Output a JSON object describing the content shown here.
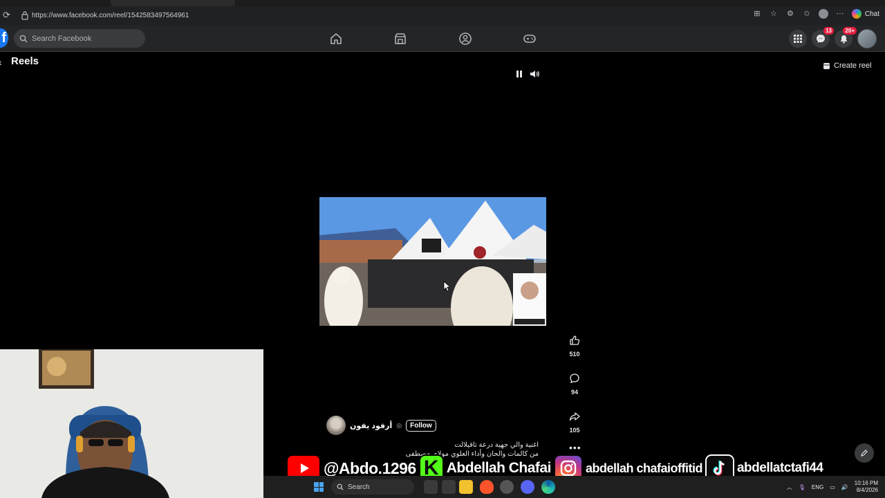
{
  "browser": {
    "url": "https://www.facebook.com/reel/1542583497564961",
    "chat_label": "Chat"
  },
  "facebook": {
    "search_placeholder": "Search Facebook",
    "messenger_badge": "13",
    "notifications_badge": "20+"
  },
  "reels": {
    "title": "Reels",
    "create_reel_label": "Create reel"
  },
  "actions": {
    "likes": "510",
    "comments": "94",
    "shares": "105"
  },
  "author": {
    "name": "أرفود يفون",
    "follow_label": "Follow"
  },
  "caption": {
    "line1": "اغنية والي جهية درعة تافيلالت",
    "line2": "من كالمات والحان وأداء العلوي مولاي مصطفى"
  },
  "social_overlay": {
    "youtube": "@Abdo.1296",
    "kick": "Abdellah Chafai",
    "instagram": "abdellah chafaioffitid",
    "tiktok": "abdellatctafi44"
  },
  "taskbar": {
    "search_label": "Search",
    "language": "ENG",
    "time": "10:16 PM",
    "date": "8/4/2026"
  },
  "colors": {
    "facebook_blue": "#1877f2",
    "badge_red": "#e41e3f",
    "youtube_red": "#ff0000",
    "kick_green": "#53fc18"
  }
}
